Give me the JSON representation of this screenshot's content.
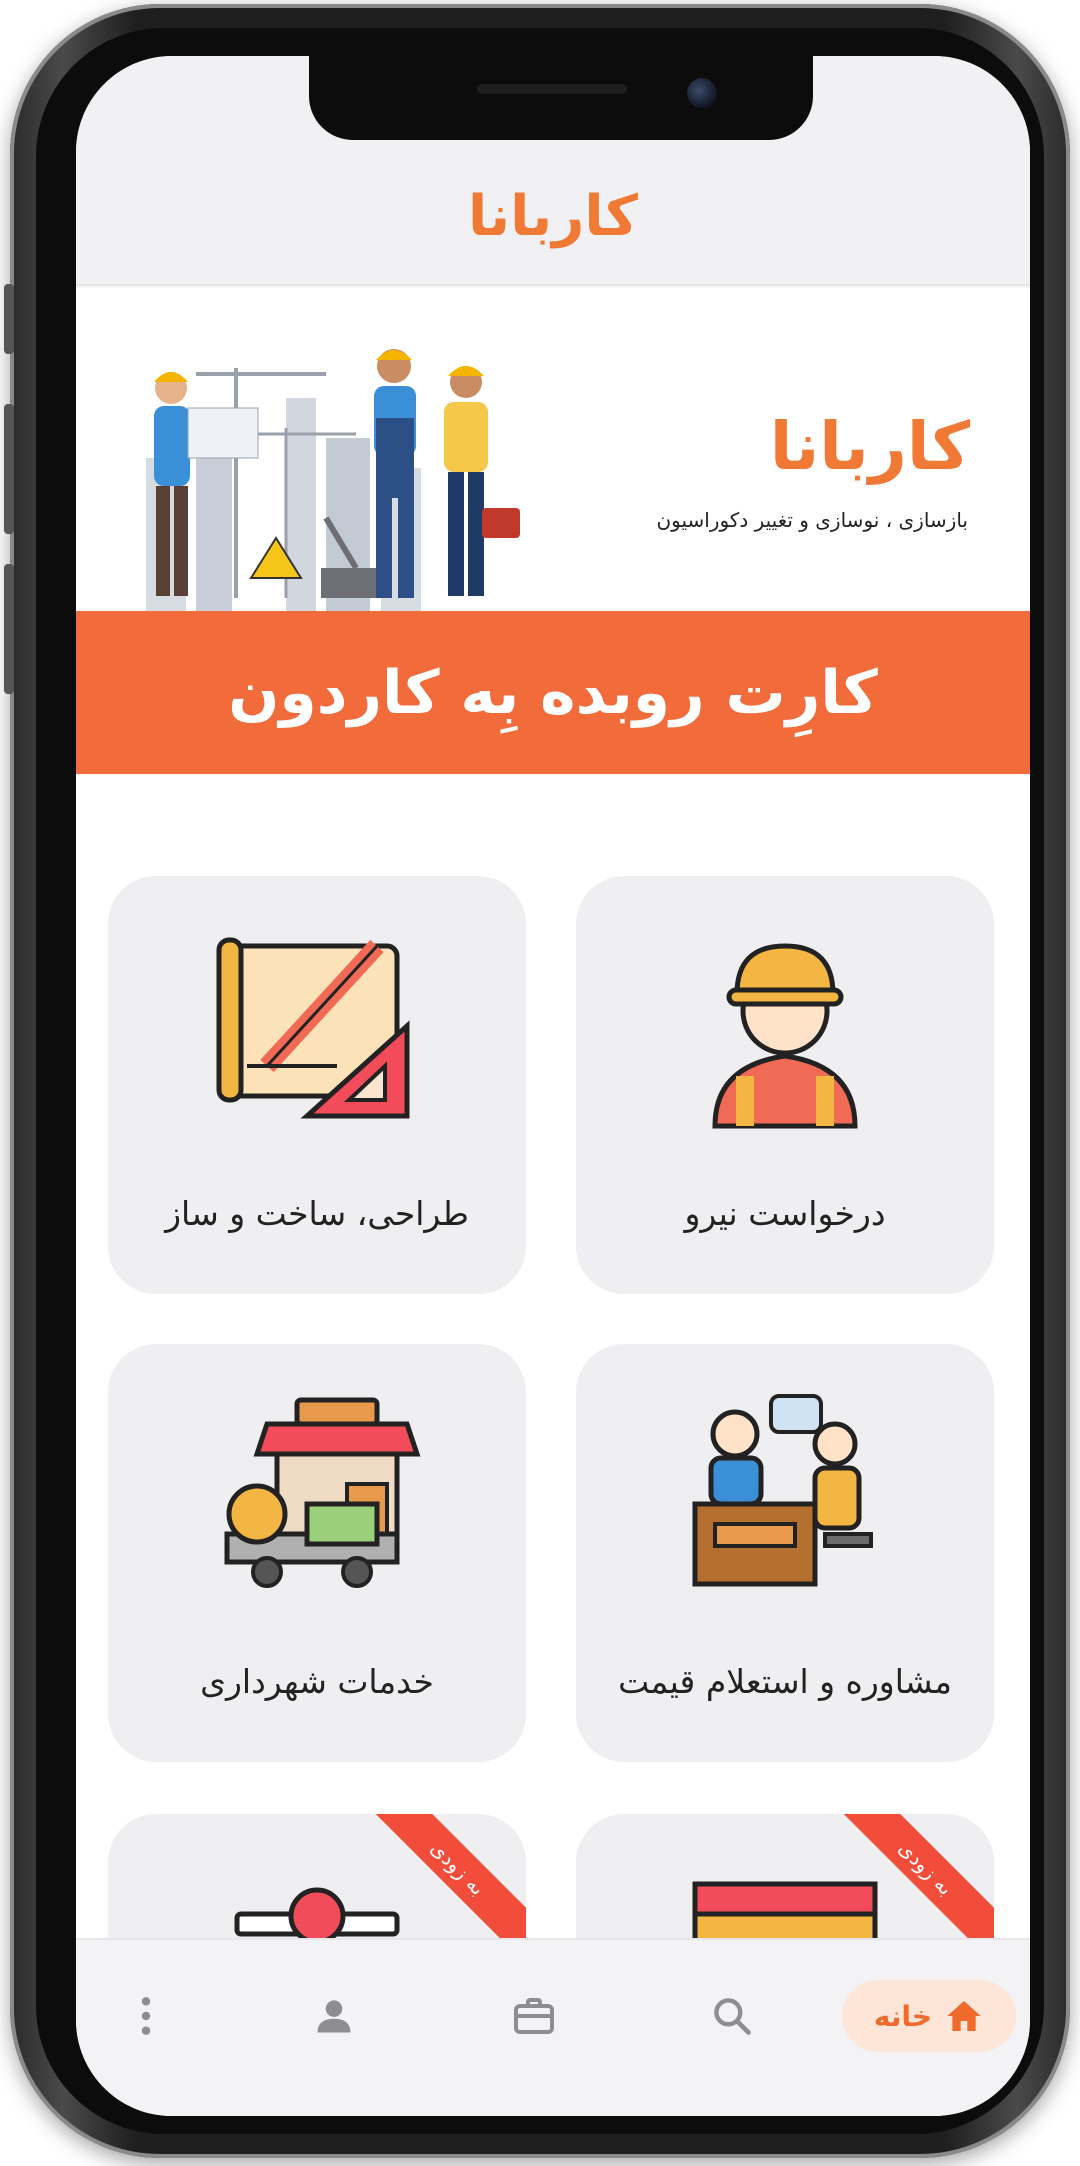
{
  "header": {
    "logo_main": "کاربانا",
    "logo_accent": ""
  },
  "banner": {
    "logo": "کاربانا",
    "tagline": "بازسازی ، نوسازی و تغییر دکوراسیون",
    "strip_text": "کارِت روبده بِه کاردون"
  },
  "services": [
    {
      "label": "درخواست نیرو",
      "icon": "worker-icon",
      "badge": ""
    },
    {
      "label": "طراحی، ساخت و ساز",
      "icon": "blueprint-icon",
      "badge": ""
    },
    {
      "label": "مشاوره و استعلام قیمت",
      "icon": "consultation-icon",
      "badge": ""
    },
    {
      "label": "خدمات شهرداری",
      "icon": "municipal-services-icon",
      "badge": ""
    },
    {
      "label": "",
      "icon": "repair-shop-icon",
      "badge": "به زودی"
    },
    {
      "label": "",
      "icon": "store-icon",
      "badge": "به زودی"
    }
  ],
  "bottom_nav": {
    "home_label": "خانه",
    "items": [
      "home-icon",
      "search-icon",
      "briefcase-icon",
      "profile-icon",
      "more-icon"
    ]
  },
  "colors": {
    "brand_orange": "#f07a35",
    "strip_orange": "#f26b3a",
    "ribbon_red": "#f24c3a",
    "card_bg": "#efeff1"
  }
}
